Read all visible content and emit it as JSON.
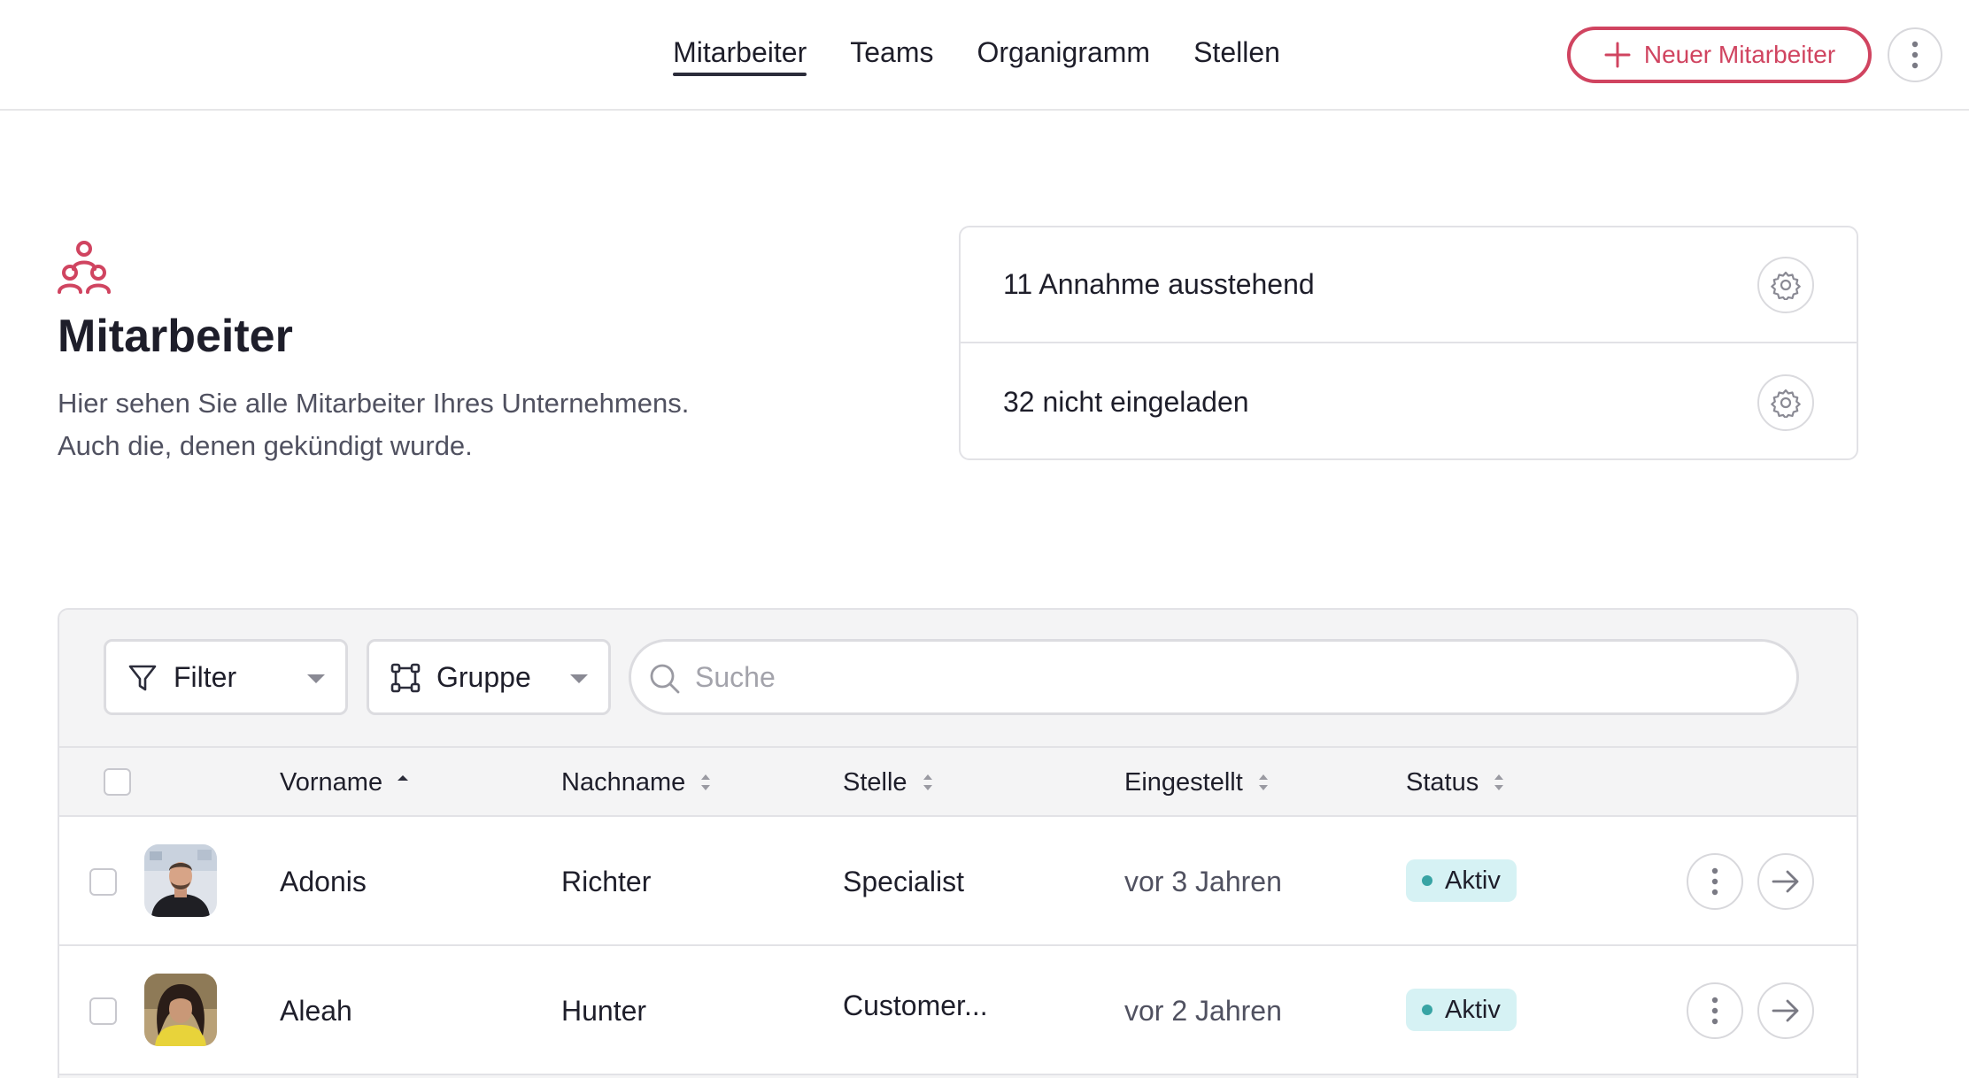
{
  "nav": {
    "tabs": [
      {
        "label": "Mitarbeiter",
        "active": true
      },
      {
        "label": "Teams",
        "active": false
      },
      {
        "label": "Organigramm",
        "active": false
      },
      {
        "label": "Stellen",
        "active": false
      }
    ],
    "new_button_label": "Neuer Mitarbeiter",
    "new_button_icon": "plus-icon",
    "more_icon": "more-vertical-icon"
  },
  "header": {
    "icon": "people-group-icon",
    "title": "Mitarbeiter",
    "description_line1": "Hier sehen Sie alle Mitarbeiter Ihres Unternehmens.",
    "description_line2": "Auch die, denen gekündigt wurde."
  },
  "summary": {
    "items": [
      {
        "text": "11 Annahme ausstehend",
        "icon": "gear-icon"
      },
      {
        "text": "32 nicht eingeladen",
        "icon": "gear-icon"
      }
    ]
  },
  "toolbar": {
    "filter_label": "Filter",
    "filter_icon": "filter-icon",
    "group_label": "Gruppe",
    "group_icon": "group-icon",
    "search_placeholder": "Suche",
    "search_value": ""
  },
  "table": {
    "columns": [
      {
        "label": "Vorname",
        "sort": "asc"
      },
      {
        "label": "Nachname",
        "sort": "none"
      },
      {
        "label": "Stelle",
        "sort": "none"
      },
      {
        "label": "Eingestellt",
        "sort": "none"
      },
      {
        "label": "Status",
        "sort": "none"
      }
    ],
    "rows": [
      {
        "first_name": "Adonis",
        "last_name": "Richter",
        "position": "Specialist",
        "hired": "vor 3 Jahren",
        "status": "Aktiv"
      },
      {
        "first_name": "Aleah",
        "last_name": "Hunter",
        "position": "Customer...",
        "hired": "vor 2 Jahren",
        "status": "Aktiv"
      }
    ]
  },
  "colors": {
    "accent": "#d04460",
    "status_active_bg": "#d6f2f4",
    "status_active_dot": "#38a4a4",
    "panel_bg": "#f4f4f5"
  }
}
